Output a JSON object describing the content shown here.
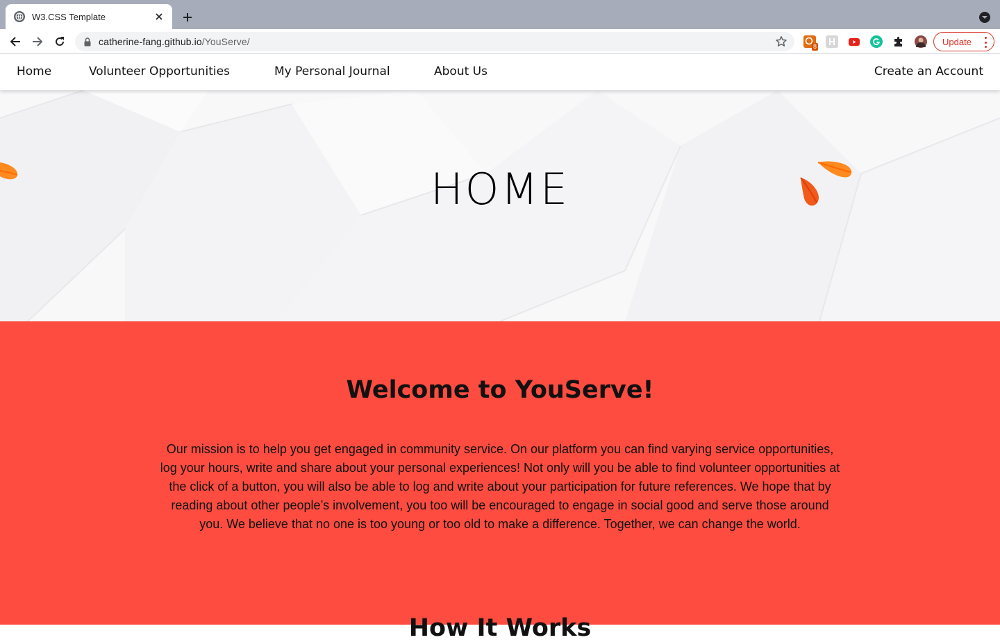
{
  "browser": {
    "tab_title": "W3.CSS Template",
    "url_host": "catherine-fang.github.io",
    "url_path": "/YouServe/",
    "update_label": "Update",
    "extension_badge": "8"
  },
  "nav": {
    "items": [
      {
        "label": "Home"
      },
      {
        "label": "Volunteer Opportunities"
      },
      {
        "label": "My Personal Journal"
      },
      {
        "label": "About Us"
      }
    ],
    "account_label": "Create an Account"
  },
  "hero": {
    "title": "HOME"
  },
  "welcome": {
    "title": "Welcome to YouServe!",
    "text": "Our mission is to help you get engaged in community service. On our platform you can find varying service opportunities, log your hours, write and share about your personal experiences! Not only will you be able to find volunteer opportunities at the click of a button, you will also be able to log and write about your participation for future references. We hope that by reading about other people’s involvement, you too will be encouraged to engage in social good and serve those around you. We believe that no one is too young or too old to make a difference. Together, we can change the world.",
    "next_heading": "How It Works"
  },
  "colors": {
    "accent": "#ff4c40",
    "tabstrip": "#a6acb9",
    "update": "#d93025",
    "leaf": "#ff8a1f"
  }
}
